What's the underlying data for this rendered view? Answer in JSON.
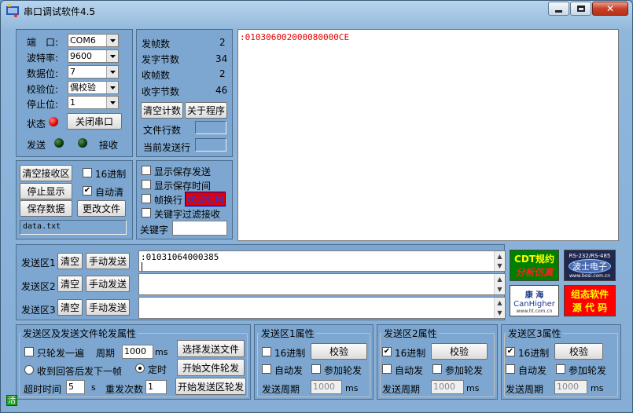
{
  "window": {
    "title": "串口调试软件4.5"
  },
  "serial": {
    "port_label": "端　口:",
    "port_value": "COM6",
    "baud_label": "波特率:",
    "baud_value": "9600",
    "databits_label": "数据位:",
    "databits_value": "7",
    "parity_label": "校验位:",
    "parity_value": "偶校验",
    "stopbits_label": "停止位:",
    "stopbits_value": "1",
    "status_label": "状态",
    "close_port_btn": "关闭串口",
    "send_label": "发送",
    "recv_label": "接收"
  },
  "stats": {
    "tx_frames_label": "发帧数",
    "tx_frames": "2",
    "tx_bytes_label": "发字节数",
    "tx_bytes": "34",
    "rx_frames_label": "收帧数",
    "rx_frames": "2",
    "rx_bytes_label": "收字节数",
    "rx_bytes": "46",
    "clear_count_btn": "清空计数",
    "about_btn": "关于程序",
    "file_lines_label": "文件行数",
    "current_line_label": "当前发送行"
  },
  "recv_ctrl": {
    "clear_btn": "清空接收区",
    "hex_label": "16进制",
    "stop_btn": "停止显示",
    "autoclear_label": "自动清",
    "save_btn": "保存数据",
    "change_file_btn": "更改文件",
    "filename": "data.txt"
  },
  "display_opts": {
    "show_save_send": "显示保存发送",
    "show_save_time": "显示保存时间",
    "frame_newline": "帧换行",
    "welcome": "欢迎使用",
    "keyword_filter": "关键字过滤接收",
    "keyword_label": "关键字"
  },
  "receive_text": ":010306002000080000CE",
  "send_areas": [
    {
      "label": "发送区1",
      "clear": "清空",
      "manual": "手动发送",
      "text": ":01031064000385"
    },
    {
      "label": "发送区2",
      "clear": "清空",
      "manual": "手动发送",
      "text": ""
    },
    {
      "label": "发送区3",
      "clear": "清空",
      "manual": "手动发送",
      "text": ""
    }
  ],
  "ads": {
    "cdt_line1": "CDT规约",
    "cdt_line2": "分析仿真",
    "bosi_top": "RS-232/RS-485",
    "bosi_name": "波士电子",
    "bosi_url": "www.bosi.com.cn",
    "kh_cn": "康 海",
    "kh_en": "CanHigher",
    "kh_url": "www.ht.com.cn",
    "zt_line1": "组态软件",
    "zt_line2": "源 代 码"
  },
  "poll": {
    "title": "发送区及发送文件轮发属性",
    "only_once": "只轮发一遍",
    "period_label": "周期",
    "period_value": "1000",
    "ms": "ms",
    "select_file_btn": "选择发送文件",
    "reply_next": "收到回答后发下一帧",
    "timed": "定时",
    "start_file_btn": "开始文件轮发",
    "timeout_label": "超时时间",
    "timeout_value": "5",
    "s": "s",
    "resend_label": "重发次数",
    "resend_value": "1",
    "start_area_btn": "开始发送区轮发"
  },
  "area_props": [
    {
      "title": "发送区1属性",
      "hex": "16进制",
      "hex_checked": false,
      "verify": "校验",
      "auto": "自动发",
      "join": "参加轮发",
      "period_label": "发送周期",
      "period": "1000",
      "ms": "ms"
    },
    {
      "title": "发送区2属性",
      "hex": "16进制",
      "hex_checked": true,
      "verify": "校验",
      "auto": "自动发",
      "join": "参加轮发",
      "period_label": "发送周期",
      "period": "1000",
      "ms": "ms"
    },
    {
      "title": "发送区3属性",
      "hex": "16进制",
      "hex_checked": true,
      "verify": "校验",
      "auto": "自动发",
      "join": "参加轮发",
      "period_label": "发送周期",
      "period": "1000",
      "ms": "ms"
    }
  ],
  "status_bar": {
    "indicator": "活"
  }
}
